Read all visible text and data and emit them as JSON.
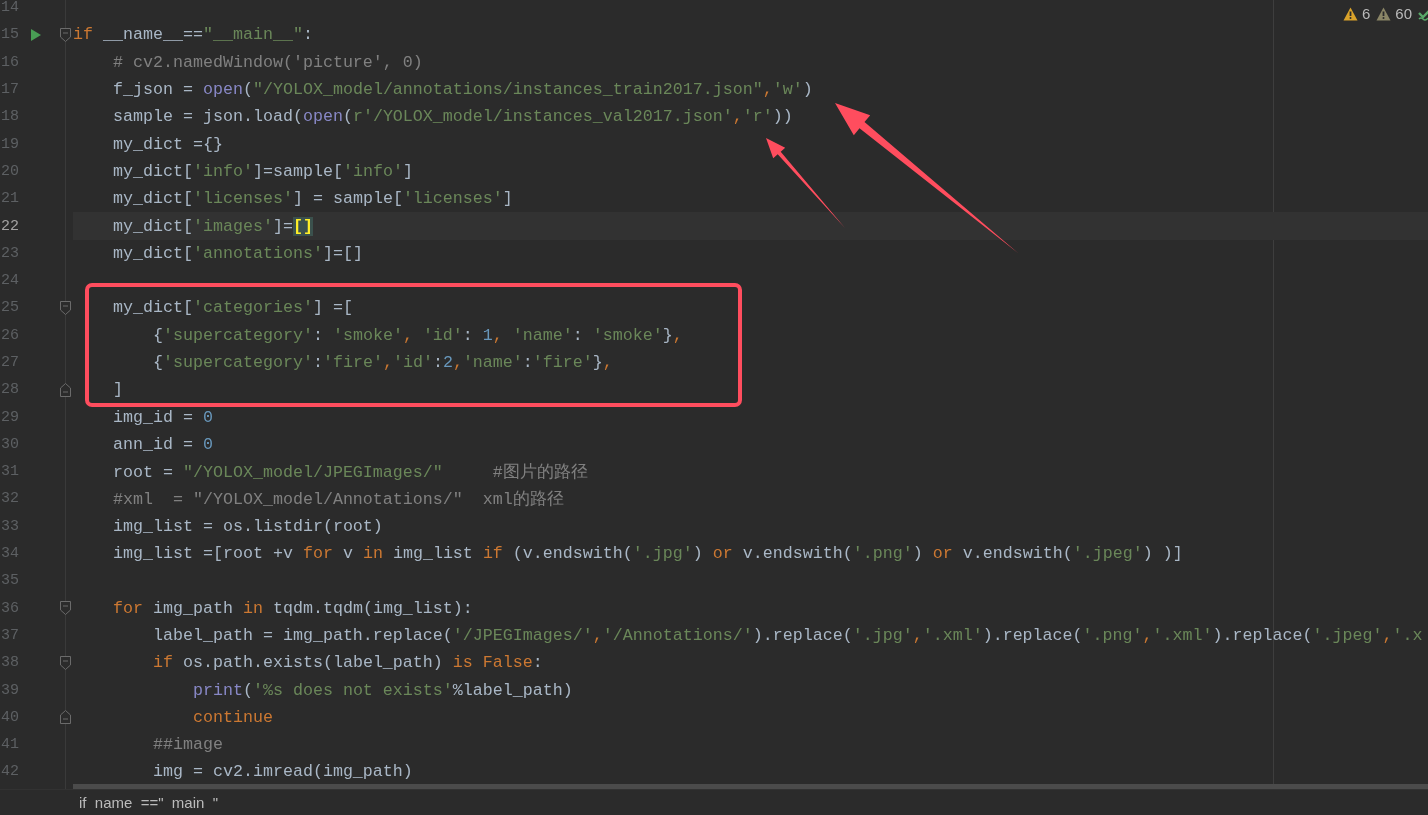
{
  "inspections": [
    {
      "kind": "warning",
      "count": "6"
    },
    {
      "kind": "weak-warning",
      "count": "60"
    }
  ],
  "lines": [
    {
      "number": "14",
      "current": false
    },
    {
      "number": "15",
      "current": false,
      "markers": [
        {
          "kind": "run"
        },
        {
          "kind": "fold-open"
        }
      ],
      "tokens": [
        {
          "kind": "kw",
          "text": "if"
        },
        {
          "kind": "plain",
          "text": " __name__=="
        },
        {
          "kind": "str",
          "text": "\"__main__\""
        },
        {
          "kind": "plain",
          "text": ":"
        }
      ]
    },
    {
      "number": "16",
      "current": false,
      "tokens": [
        {
          "kind": "comment",
          "text": "    # cv2.namedWindow('picture', 0)"
        }
      ]
    },
    {
      "number": "17",
      "current": false,
      "tokens": [
        {
          "kind": "plain",
          "text": "    f_json = "
        },
        {
          "kind": "builtin",
          "text": "open"
        },
        {
          "kind": "plain",
          "text": "("
        },
        {
          "kind": "str",
          "text": "\"/YOLOX_model/annotations/instances_train2017.json\""
        },
        {
          "kind": "kw",
          "text": ","
        },
        {
          "kind": "str",
          "text": "'w'"
        },
        {
          "kind": "plain",
          "text": ")"
        }
      ]
    },
    {
      "number": "18",
      "current": false,
      "tokens": [
        {
          "kind": "plain",
          "text": "    sample = json.load("
        },
        {
          "kind": "builtin",
          "text": "open"
        },
        {
          "kind": "plain",
          "text": "("
        },
        {
          "kind": "str",
          "text": "r'/YOLOX_model/instances_val2017.json'"
        },
        {
          "kind": "kw",
          "text": ","
        },
        {
          "kind": "str",
          "text": "'r'"
        },
        {
          "kind": "plain",
          "text": "))"
        }
      ]
    },
    {
      "number": "19",
      "current": false,
      "tokens": [
        {
          "kind": "plain",
          "text": "    my_dict ={}"
        }
      ]
    },
    {
      "number": "20",
      "current": false,
      "tokens": [
        {
          "kind": "plain",
          "text": "    my_dict["
        },
        {
          "kind": "str",
          "text": "'info'"
        },
        {
          "kind": "plain",
          "text": "]=sample["
        },
        {
          "kind": "str",
          "text": "'info'"
        },
        {
          "kind": "plain",
          "text": "]"
        }
      ]
    },
    {
      "number": "21",
      "current": false,
      "tokens": [
        {
          "kind": "plain",
          "text": "    my_dict["
        },
        {
          "kind": "str",
          "text": "'licenses'"
        },
        {
          "kind": "plain",
          "text": "] = sample["
        },
        {
          "kind": "str",
          "text": "'licenses'"
        },
        {
          "kind": "plain",
          "text": "]"
        }
      ]
    },
    {
      "number": "22",
      "current": true,
      "tokens": [
        {
          "kind": "plain",
          "text": "    my_dict["
        },
        {
          "kind": "str",
          "text": "'images'"
        },
        {
          "kind": "plain",
          "text": "]="
        },
        {
          "kind": "match",
          "text": "[]"
        }
      ]
    },
    {
      "number": "23",
      "current": false,
      "tokens": [
        {
          "kind": "plain",
          "text": "    my_dict["
        },
        {
          "kind": "str",
          "text": "'annotations'"
        },
        {
          "kind": "plain",
          "text": "]=[]"
        }
      ]
    },
    {
      "number": "24",
      "current": false
    },
    {
      "number": "25",
      "current": false,
      "markers": [
        {
          "kind": "fold-open"
        }
      ],
      "tokens": [
        {
          "kind": "plain",
          "text": "    my_dict["
        },
        {
          "kind": "str",
          "text": "'categories'"
        },
        {
          "kind": "plain",
          "text": "] =["
        }
      ]
    },
    {
      "number": "26",
      "current": false,
      "tokens": [
        {
          "kind": "plain",
          "text": "        {"
        },
        {
          "kind": "str",
          "text": "'supercategory'"
        },
        {
          "kind": "plain",
          "text": ": "
        },
        {
          "kind": "str",
          "text": "'smoke'"
        },
        {
          "kind": "kw",
          "text": ", "
        },
        {
          "kind": "str",
          "text": "'id'"
        },
        {
          "kind": "plain",
          "text": ": "
        },
        {
          "kind": "num",
          "text": "1"
        },
        {
          "kind": "kw",
          "text": ", "
        },
        {
          "kind": "str",
          "text": "'name'"
        },
        {
          "kind": "plain",
          "text": ": "
        },
        {
          "kind": "str",
          "text": "'smoke'"
        },
        {
          "kind": "plain",
          "text": "}"
        },
        {
          "kind": "kw",
          "text": ","
        }
      ]
    },
    {
      "number": "27",
      "current": false,
      "tokens": [
        {
          "kind": "plain",
          "text": "        {"
        },
        {
          "kind": "str",
          "text": "'supercategory'"
        },
        {
          "kind": "plain",
          "text": ":"
        },
        {
          "kind": "str",
          "text": "'fire'"
        },
        {
          "kind": "kw",
          "text": ","
        },
        {
          "kind": "str",
          "text": "'id'"
        },
        {
          "kind": "plain",
          "text": ":"
        },
        {
          "kind": "num",
          "text": "2"
        },
        {
          "kind": "kw",
          "text": ","
        },
        {
          "kind": "str",
          "text": "'name'"
        },
        {
          "kind": "plain",
          "text": ":"
        },
        {
          "kind": "str",
          "text": "'fire'"
        },
        {
          "kind": "plain",
          "text": "}"
        },
        {
          "kind": "kw",
          "text": ","
        }
      ]
    },
    {
      "number": "28",
      "current": false,
      "markers": [
        {
          "kind": "fold-close"
        }
      ],
      "tokens": [
        {
          "kind": "plain",
          "text": "    ]"
        }
      ]
    },
    {
      "number": "29",
      "current": false,
      "tokens": [
        {
          "kind": "plain",
          "text": "    img_id = "
        },
        {
          "kind": "num",
          "text": "0"
        }
      ]
    },
    {
      "number": "30",
      "current": false,
      "tokens": [
        {
          "kind": "plain",
          "text": "    ann_id = "
        },
        {
          "kind": "num",
          "text": "0"
        }
      ]
    },
    {
      "number": "31",
      "current": false,
      "tokens": [
        {
          "kind": "plain",
          "text": "    root = "
        },
        {
          "kind": "str",
          "text": "\"/YOLOX_model/JPEGImages/\""
        },
        {
          "kind": "comment",
          "text": "     #图片的路径"
        }
      ]
    },
    {
      "number": "32",
      "current": false,
      "tokens": [
        {
          "kind": "comment",
          "text": "    #xml  = \"/YOLOX_model/Annotations/\"  xml的路径"
        }
      ]
    },
    {
      "number": "33",
      "current": false,
      "tokens": [
        {
          "kind": "plain",
          "text": "    img_list = os.listdir(root)"
        }
      ]
    },
    {
      "number": "34",
      "current": false,
      "tokens": [
        {
          "kind": "plain",
          "text": "    img_list =[root +v "
        },
        {
          "kind": "kw",
          "text": "for"
        },
        {
          "kind": "plain",
          "text": " v "
        },
        {
          "kind": "kw",
          "text": "in"
        },
        {
          "kind": "plain",
          "text": " img_list "
        },
        {
          "kind": "kw",
          "text": "if"
        },
        {
          "kind": "plain",
          "text": " (v.endswith("
        },
        {
          "kind": "str",
          "text": "'.jpg'"
        },
        {
          "kind": "plain",
          "text": ") "
        },
        {
          "kind": "kw",
          "text": "or"
        },
        {
          "kind": "plain",
          "text": " v.endswith("
        },
        {
          "kind": "str",
          "text": "'.png'"
        },
        {
          "kind": "plain",
          "text": ") "
        },
        {
          "kind": "kw",
          "text": "or"
        },
        {
          "kind": "plain",
          "text": " v.endswith("
        },
        {
          "kind": "str",
          "text": "'.jpeg'"
        },
        {
          "kind": "plain",
          "text": ") )]"
        }
      ]
    },
    {
      "number": "35",
      "current": false
    },
    {
      "number": "36",
      "current": false,
      "markers": [
        {
          "kind": "fold-open"
        }
      ],
      "tokens": [
        {
          "kind": "kw",
          "text": "    for"
        },
        {
          "kind": "plain",
          "text": " img_path "
        },
        {
          "kind": "kw",
          "text": "in"
        },
        {
          "kind": "plain",
          "text": " tqdm.tqdm(img_list):"
        }
      ]
    },
    {
      "number": "37",
      "current": false,
      "tokens": [
        {
          "kind": "plain",
          "text": "        label_path = img_path.replace("
        },
        {
          "kind": "str",
          "text": "'/JPEGImages/'"
        },
        {
          "kind": "kw",
          "text": ","
        },
        {
          "kind": "str",
          "text": "'/Annotations/'"
        },
        {
          "kind": "plain",
          "text": ").replace("
        },
        {
          "kind": "str",
          "text": "'.jpg'"
        },
        {
          "kind": "kw",
          "text": ","
        },
        {
          "kind": "str",
          "text": "'.xml'"
        },
        {
          "kind": "plain",
          "text": ").replace("
        },
        {
          "kind": "str",
          "text": "'.png'"
        },
        {
          "kind": "kw",
          "text": ","
        },
        {
          "kind": "str",
          "text": "'.xml'"
        },
        {
          "kind": "plain",
          "text": ").replace("
        },
        {
          "kind": "str",
          "text": "'.jpeg'"
        },
        {
          "kind": "kw",
          "text": ","
        },
        {
          "kind": "str",
          "text": "'.x"
        }
      ]
    },
    {
      "number": "38",
      "current": false,
      "markers": [
        {
          "kind": "fold-open"
        }
      ],
      "tokens": [
        {
          "kind": "kw",
          "text": "        if"
        },
        {
          "kind": "plain",
          "text": " os.path.exists(label_path) "
        },
        {
          "kind": "kw",
          "text": "is False"
        },
        {
          "kind": "plain",
          "text": ":"
        }
      ]
    },
    {
      "number": "39",
      "current": false,
      "tokens": [
        {
          "kind": "builtin",
          "text": "            print"
        },
        {
          "kind": "plain",
          "text": "("
        },
        {
          "kind": "str",
          "text": "'%s does not exists'"
        },
        {
          "kind": "plain",
          "text": "%label_path)"
        }
      ]
    },
    {
      "number": "40",
      "current": false,
      "markers": [
        {
          "kind": "fold-close"
        }
      ],
      "tokens": [
        {
          "kind": "kw",
          "text": "            continue"
        }
      ]
    },
    {
      "number": "41",
      "current": false,
      "tokens": [
        {
          "kind": "comment",
          "text": "        ##image"
        }
      ]
    },
    {
      "number": "42",
      "current": false,
      "tokens": [
        {
          "kind": "plain",
          "text": "        img = cv2.imread(img_path)"
        }
      ]
    }
  ],
  "annotations": [
    {
      "kind": "box",
      "color": "#ff4d5e"
    },
    {
      "kind": "arrow",
      "color": "#ff4d5e"
    },
    {
      "kind": "arrow",
      "color": "#ff4d5e"
    }
  ],
  "breadcrumb": "if  name  ==\"  main  \""
}
